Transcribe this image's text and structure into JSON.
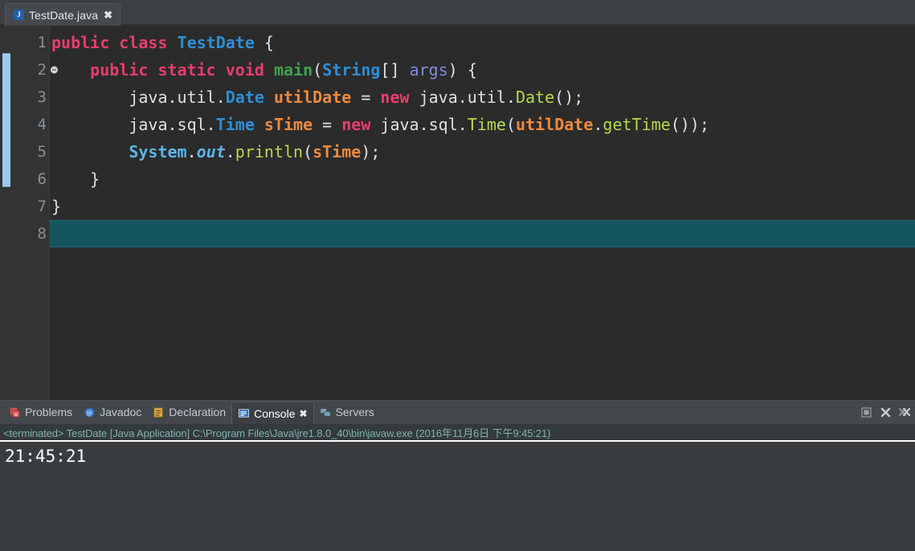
{
  "editor": {
    "tab": {
      "title": "TestDate.java",
      "icon": "java-file-icon",
      "icon_letter": "J",
      "close": "✖"
    },
    "current_line": 8,
    "lines": [
      {
        "n": "1",
        "tokens": [
          {
            "t": "public",
            "c": "kw"
          },
          {
            "t": " ",
            "c": "pln"
          },
          {
            "t": "class",
            "c": "kw"
          },
          {
            "t": " ",
            "c": "pln"
          },
          {
            "t": "TestDate",
            "c": "type"
          },
          {
            "t": " {",
            "c": "pln"
          }
        ]
      },
      {
        "n": "2",
        "fold": true,
        "tokens": [
          {
            "t": "    ",
            "c": "pln"
          },
          {
            "t": "public",
            "c": "kw"
          },
          {
            "t": " ",
            "c": "pln"
          },
          {
            "t": "static",
            "c": "kw"
          },
          {
            "t": " ",
            "c": "pln"
          },
          {
            "t": "void",
            "c": "kw"
          },
          {
            "t": " ",
            "c": "pln"
          },
          {
            "t": "main",
            "c": "meth"
          },
          {
            "t": "(",
            "c": "pln"
          },
          {
            "t": "String",
            "c": "type"
          },
          {
            "t": "[] ",
            "c": "pln"
          },
          {
            "t": "args",
            "c": "param"
          },
          {
            "t": ") {",
            "c": "pln"
          }
        ]
      },
      {
        "n": "3",
        "tokens": [
          {
            "t": "        java.util.",
            "c": "pln"
          },
          {
            "t": "Date",
            "c": "type"
          },
          {
            "t": " ",
            "c": "pln"
          },
          {
            "t": "utilDate",
            "c": "var"
          },
          {
            "t": " = ",
            "c": "pln"
          },
          {
            "t": "new",
            "c": "kw"
          },
          {
            "t": " java.util.",
            "c": "pln"
          },
          {
            "t": "Date",
            "c": "ctor"
          },
          {
            "t": "();",
            "c": "pln"
          }
        ]
      },
      {
        "n": "4",
        "tokens": [
          {
            "t": "        java.sql.",
            "c": "pln"
          },
          {
            "t": "Time",
            "c": "type"
          },
          {
            "t": " ",
            "c": "pln"
          },
          {
            "t": "sTime",
            "c": "var"
          },
          {
            "t": " = ",
            "c": "pln"
          },
          {
            "t": "new",
            "c": "kw"
          },
          {
            "t": " java.sql.",
            "c": "pln"
          },
          {
            "t": "Time",
            "c": "ctor"
          },
          {
            "t": "(",
            "c": "pln"
          },
          {
            "t": "utilDate",
            "c": "var"
          },
          {
            "t": ".",
            "c": "pln"
          },
          {
            "t": "getTime",
            "c": "call"
          },
          {
            "t": "());",
            "c": "pln"
          }
        ]
      },
      {
        "n": "5",
        "tokens": [
          {
            "t": "        ",
            "c": "pln"
          },
          {
            "t": "System",
            "c": "fldc"
          },
          {
            "t": ".",
            "c": "pln"
          },
          {
            "t": "out",
            "c": "fld"
          },
          {
            "t": ".",
            "c": "pln"
          },
          {
            "t": "println",
            "c": "call"
          },
          {
            "t": "(",
            "c": "pln"
          },
          {
            "t": "sTime",
            "c": "var"
          },
          {
            "t": ");",
            "c": "pln"
          }
        ]
      },
      {
        "n": "6",
        "tokens": [
          {
            "t": "    }",
            "c": "pln"
          }
        ]
      },
      {
        "n": "7",
        "tokens": [
          {
            "t": "}",
            "c": "pln"
          }
        ]
      },
      {
        "n": "8",
        "tokens": [
          {
            "t": "",
            "c": "pln"
          }
        ]
      }
    ]
  },
  "bottom_panel": {
    "tabs": [
      {
        "label": "Problems",
        "icon": "problems-icon",
        "active": false,
        "closable": false
      },
      {
        "label": "Javadoc",
        "icon": "javadoc-icon",
        "active": false,
        "closable": false
      },
      {
        "label": "Declaration",
        "icon": "declaration-icon",
        "active": false,
        "closable": false
      },
      {
        "label": "Console",
        "icon": "console-icon",
        "active": true,
        "closable": true
      },
      {
        "label": "Servers",
        "icon": "servers-icon",
        "active": false,
        "closable": false
      }
    ],
    "tab_close_glyph": "✖",
    "toolbar": [
      {
        "name": "maximize-button",
        "icon": "maximize-icon"
      },
      {
        "name": "close-console-button",
        "icon": "close-icon"
      },
      {
        "name": "close-all-button",
        "icon": "close-all-icon"
      }
    ],
    "status": "<terminated> TestDate [Java Application] C:\\Program Files\\Java\\jre1.8.0_40\\bin\\javaw.exe (2016年11月6日 下午9:45:21)",
    "console_output": "21:45:21"
  },
  "colors": {
    "editor_bg": "#2b2b2b",
    "gutter_bg": "#313335",
    "current_line": "#15555f",
    "keyword": "#e83e6d",
    "type": "#2d8fd5",
    "method": "#3fa34b",
    "variable": "#f08a3c",
    "call": "#b6d94c",
    "param": "#7d8ce0",
    "status_text": "#7fb3ae",
    "console_text": "#ffffff",
    "marker_bar": "#9ec7f0"
  }
}
